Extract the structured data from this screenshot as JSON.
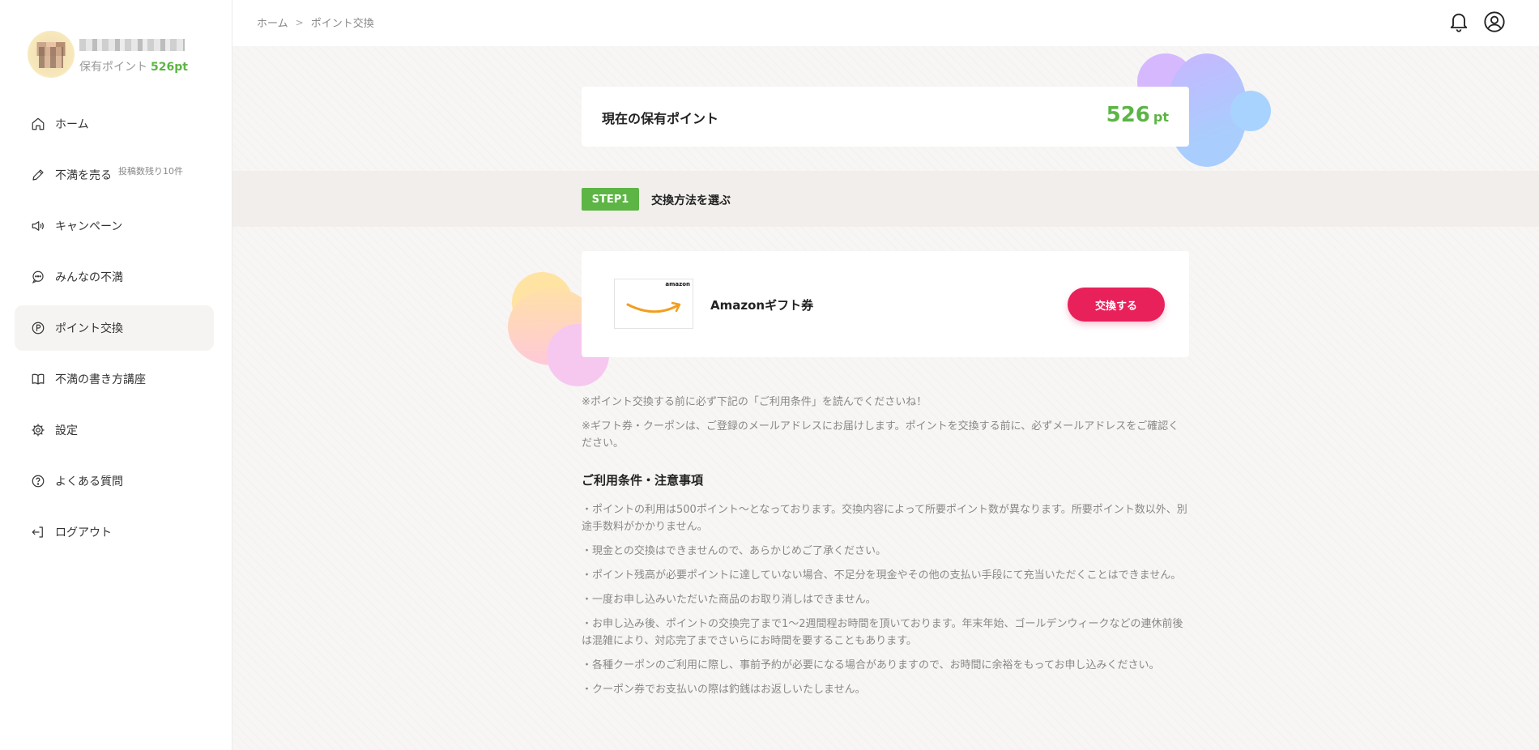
{
  "profile": {
    "username": "■■■ ■■■ ■■■",
    "points_label": "保有ポイント",
    "points_value": "526pt"
  },
  "sidebar": {
    "items": [
      {
        "label": "ホーム",
        "icon": "home-icon"
      },
      {
        "label": "不満を売る",
        "note": "投稿数残り10件",
        "icon": "pencil-icon"
      },
      {
        "label": "キャンペーン",
        "icon": "megaphone-icon"
      },
      {
        "label": "みんなの不満",
        "icon": "chat-icon"
      },
      {
        "label": "ポイント交換",
        "icon": "point-p-icon",
        "active": true
      },
      {
        "label": "不満の書き方講座",
        "icon": "book-icon"
      },
      {
        "label": "設定",
        "icon": "gear-icon"
      },
      {
        "label": "よくある質問",
        "icon": "help-icon"
      },
      {
        "label": "ログアウト",
        "icon": "logout-icon"
      }
    ]
  },
  "breadcrumb": {
    "home": "ホーム",
    "separator": ">",
    "current": "ポイント交換"
  },
  "points_card": {
    "title": "現在の保有ポイント",
    "amount": "526",
    "unit": "pt"
  },
  "step": {
    "badge": "STEP1",
    "title": "交換方法を選ぶ"
  },
  "gift": {
    "logo_text": "amazon",
    "name": "Amazonギフト券",
    "button_label": "交換する"
  },
  "notes": [
    "※ポイント交換する前に必ず下記の「ご利用条件」を読んでくださいね！",
    "※ギフト券・クーポンは、ご登録のメールアドレスにお届けします。ポイントを交換する前に、必ずメールアドレスをご確認ください。"
  ],
  "terms": {
    "title": "ご利用条件・注意事項",
    "items": [
      "・ポイントの利用は500ポイント〜となっております。交換内容によって所要ポイント数が異なります。所要ポイント数以外、別途手数料がかかりません。",
      "・現金との交換はできませんので、あらかじめご了承ください。",
      "・ポイント残高が必要ポイントに達していない場合、不足分を現金やその他の支払い手段にて充当いただくことはできません。",
      "・一度お申し込みいただいた商品のお取り消しはできません。",
      "・お申し込み後、ポイントの交換完了まで1〜2週間程お時間を頂いております。年末年始、ゴールデンウィークなどの連休前後は混雑により、対応完了までさいらにお時間を要することもあります。",
      "・各種クーポンのご利用に際し、事前予約が必要になる場合がありますので、お時間に余裕をもってお申し込みください。",
      "・クーポン券でお支払いの際は釣銭はお返しいたしません。"
    ]
  },
  "colors": {
    "accent_green": "#5cb544",
    "button_pink": "#e8215b",
    "amazon_orange": "#f19e20"
  }
}
